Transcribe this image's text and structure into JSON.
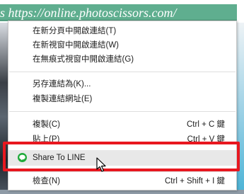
{
  "background": {
    "link_text": "s https://online.photoscissors.com/",
    "link_color": "#5fae8f"
  },
  "menu": {
    "items": [
      {
        "label": "在新分頁中開啟連結(T)",
        "shortcut": ""
      },
      {
        "label": "在新視窗中開啟連結(W)",
        "shortcut": ""
      },
      {
        "label": "在無痕式視窗中開啟連結(G)",
        "shortcut": ""
      },
      {
        "label": "另存連結為(K)...",
        "shortcut": ""
      },
      {
        "label": "複製連結網址(E)",
        "shortcut": ""
      },
      {
        "label": "複製(C)",
        "shortcut": "Ctrl + C 鍵"
      },
      {
        "label": "貼上(P)",
        "shortcut": "Ctrl + V 鍵"
      },
      {
        "label": "Share To LINE",
        "shortcut": "",
        "icon": "line-icon",
        "highlighted": true
      },
      {
        "label": "檢查(N)",
        "shortcut": "Ctrl + Shift + I 鍵"
      }
    ]
  },
  "colors": {
    "highlight_border": "#e8171f",
    "line_green": "#1faa3a"
  }
}
